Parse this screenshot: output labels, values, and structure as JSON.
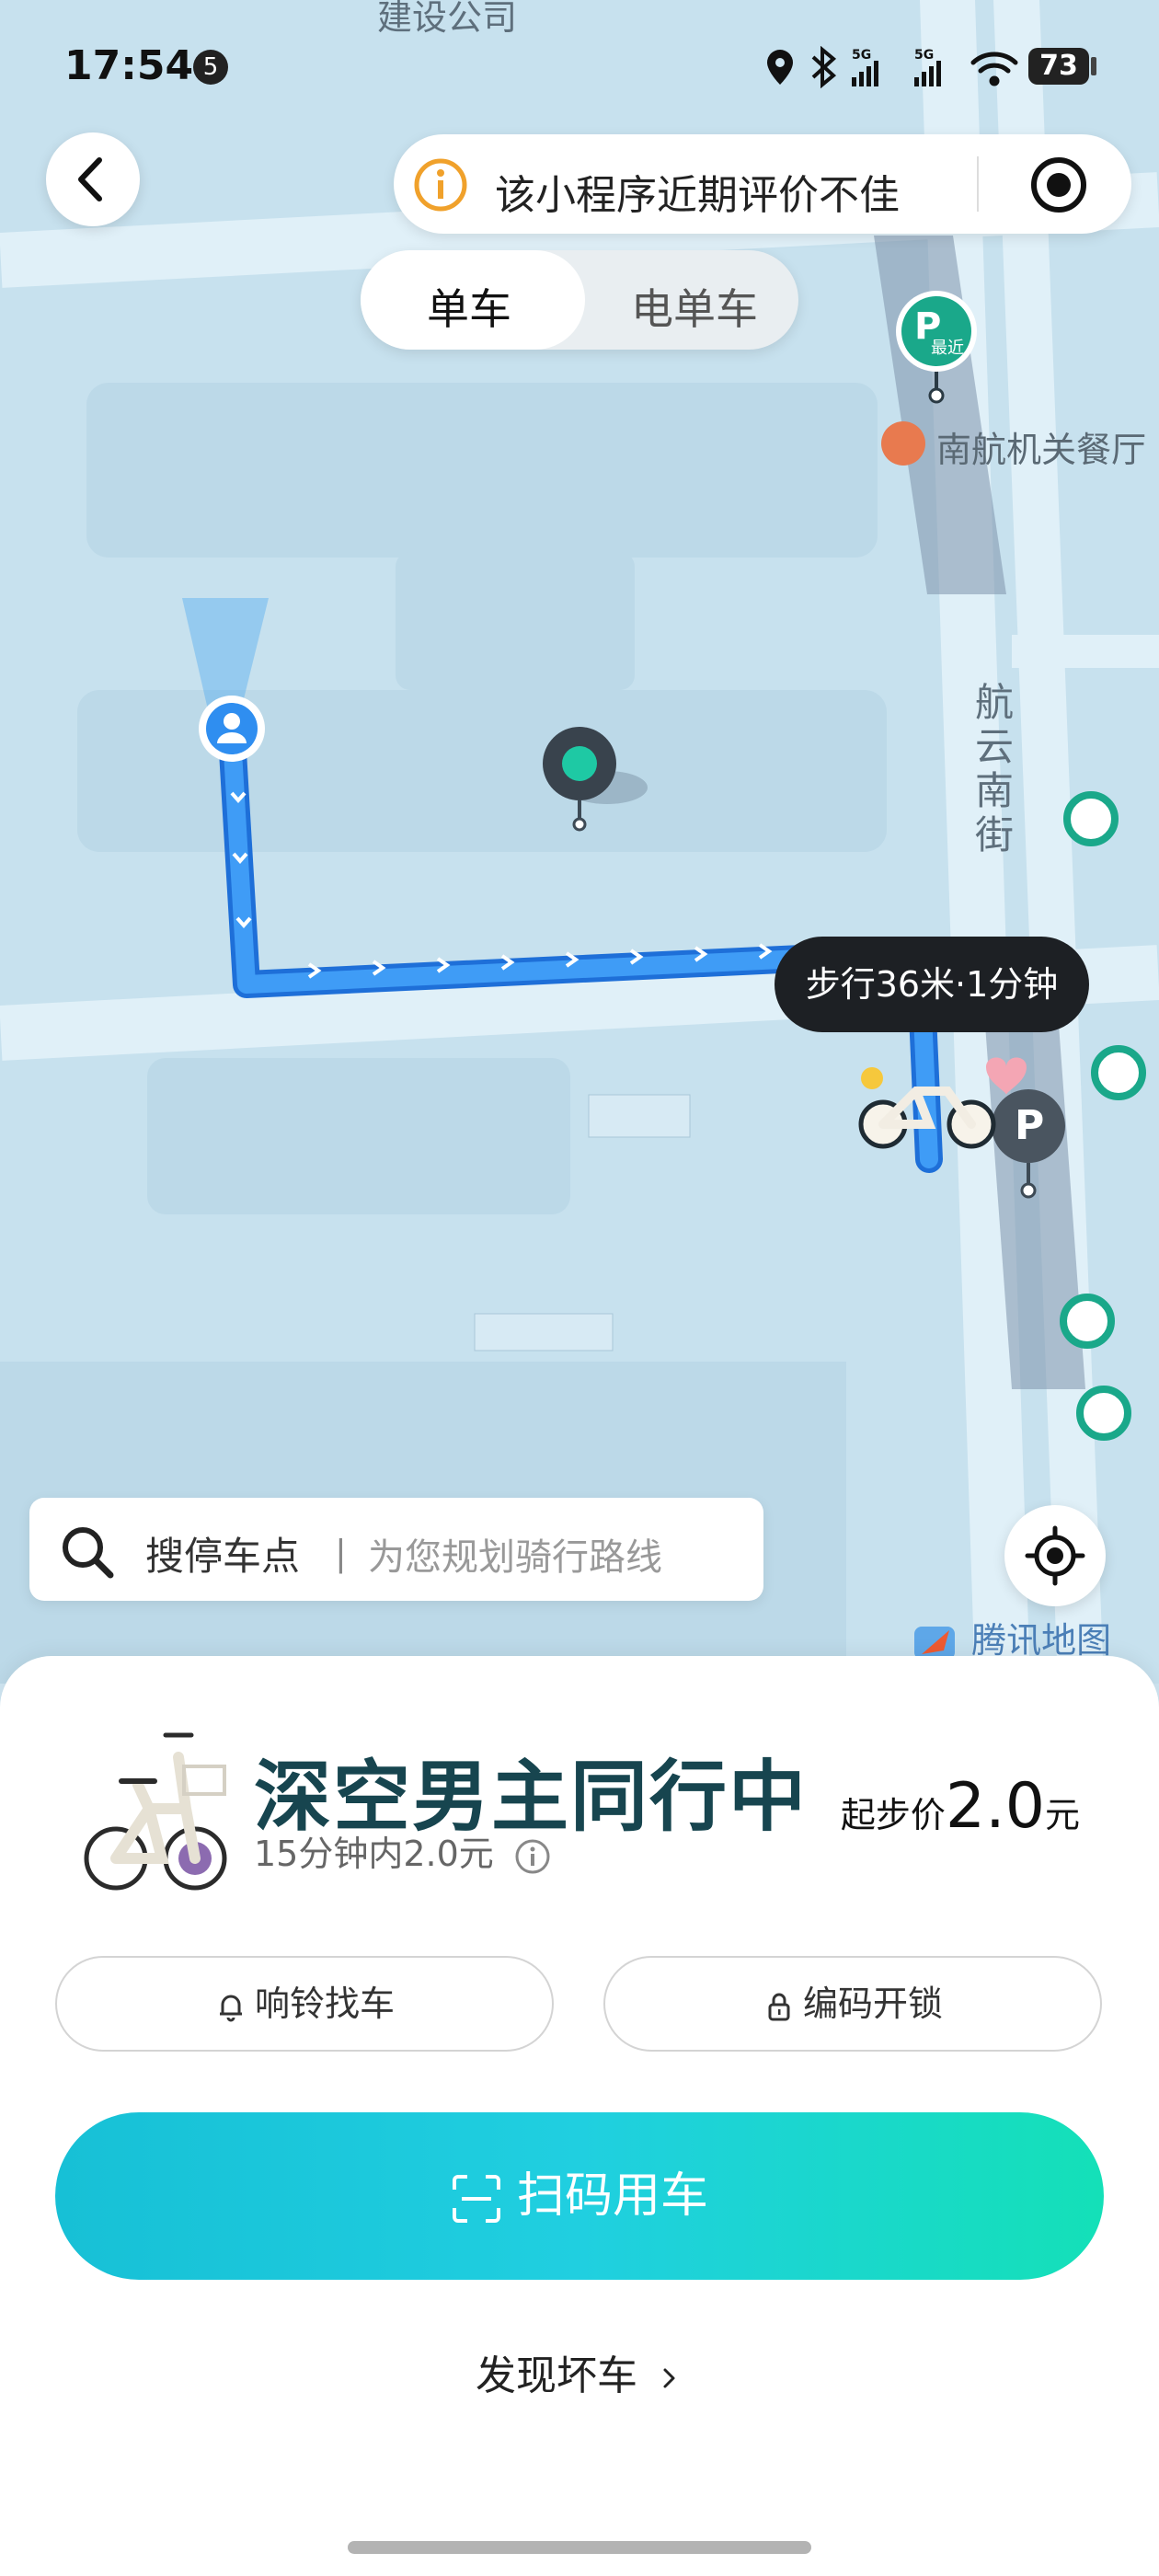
{
  "status_bar": {
    "time": "17:54",
    "notification_count": "5",
    "battery": "73"
  },
  "map": {
    "labels": {
      "top_poi": "建设公司",
      "restaurant": "南航机关餐厅",
      "street": "航云南街"
    },
    "parking_nearest": "最近",
    "parking_letter": "P",
    "walk_tip": "步行36米·1分钟",
    "attribution": "腾讯地图"
  },
  "notice": {
    "text": "该小程序近期评价不佳"
  },
  "mode_tabs": [
    {
      "label": "单车",
      "active": true
    },
    {
      "label": "电单车",
      "active": false
    }
  ],
  "search": {
    "label": "搜停车点",
    "separator": "|",
    "placeholder": "为您规划骑行路线"
  },
  "bike": {
    "title": "深空男主同行中",
    "subtitle": "15分钟内2.0元",
    "price_label": "起步价",
    "price_value": "2.0",
    "price_unit": "元"
  },
  "actions": {
    "ring": "响铃找车",
    "code_unlock": "编码开锁",
    "scan": "扫码用车",
    "report": "发现坏车"
  },
  "colors": {
    "accent": "#17c0d6",
    "accent_end": "#14e0b8",
    "route": "#2f8ef0",
    "parking_green": "#1aa88a",
    "title": "#17454f"
  }
}
